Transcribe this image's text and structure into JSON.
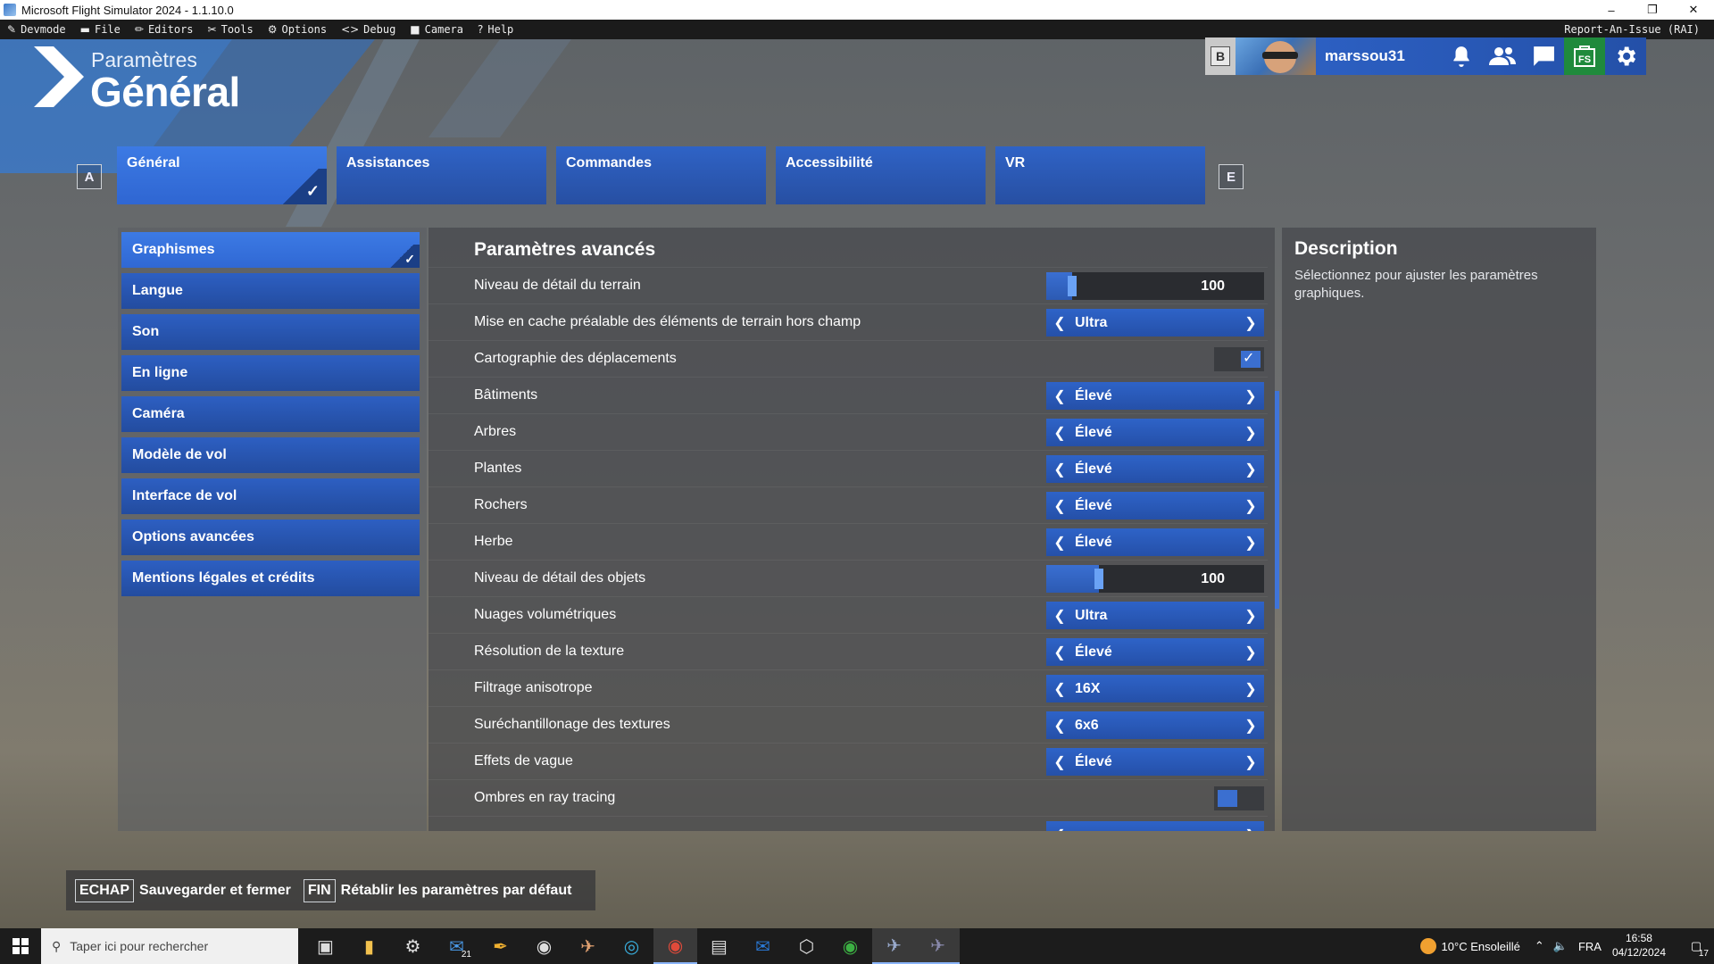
{
  "window": {
    "title": "Microsoft Flight Simulator 2024 - 1.1.10.0",
    "minimize": "–",
    "maximize": "❐",
    "close": "✕"
  },
  "devmenu": {
    "items": [
      {
        "icon": "✎",
        "label": "Devmode"
      },
      {
        "icon": "▬",
        "label": "File"
      },
      {
        "icon": "✏",
        "label": "Editors"
      },
      {
        "icon": "✂",
        "label": "Tools"
      },
      {
        "icon": "⚙",
        "label": "Options"
      },
      {
        "icon": "<>",
        "label": "Debug"
      },
      {
        "icon": "■",
        "label": "Camera"
      },
      {
        "icon": "?",
        "label": "Help"
      }
    ],
    "report": "Report-An-Issue (RAI)"
  },
  "header": {
    "subtitle": "Paramètres",
    "title": "Général"
  },
  "user": {
    "key": "B",
    "username": "marssou31",
    "icons": [
      "bell-icon",
      "friends-icon",
      "chat-icon",
      "store-icon",
      "settings-gear-icon"
    ]
  },
  "tabs": {
    "prev_key": "A",
    "next_key": "E",
    "items": [
      {
        "label": "Général",
        "active": true
      },
      {
        "label": "Assistances",
        "active": false
      },
      {
        "label": "Commandes",
        "active": false
      },
      {
        "label": "Accessibilité",
        "active": false
      },
      {
        "label": "VR",
        "active": false
      }
    ]
  },
  "left_menu": [
    {
      "label": "Graphismes",
      "active": true
    },
    {
      "label": "Langue"
    },
    {
      "label": "Son"
    },
    {
      "label": "En ligne"
    },
    {
      "label": "Caméra"
    },
    {
      "label": "Modèle de vol"
    },
    {
      "label": "Interface de vol"
    },
    {
      "label": "Options avancées"
    },
    {
      "label": "Mentions légales et crédits"
    }
  ],
  "settings": {
    "title": "Paramètres avancés",
    "rows": [
      {
        "label": "Niveau de détail du terrain",
        "type": "slider",
        "value": "100",
        "level": 0.12
      },
      {
        "label": "Mise en cache préalable des éléments de terrain hors champ",
        "type": "select",
        "value": "Ultra"
      },
      {
        "label": "Cartographie des déplacements",
        "type": "toggle",
        "on": true
      },
      {
        "label": "Bâtiments",
        "type": "select",
        "value": "Élevé"
      },
      {
        "label": "Arbres",
        "type": "select",
        "value": "Élevé"
      },
      {
        "label": "Plantes",
        "type": "select",
        "value": "Élevé"
      },
      {
        "label": "Rochers",
        "type": "select",
        "value": "Élevé"
      },
      {
        "label": "Herbe",
        "type": "select",
        "value": "Élevé"
      },
      {
        "label": "Niveau de détail des objets",
        "type": "slider",
        "value": "100",
        "level": 0.24
      },
      {
        "label": "Nuages volumétriques",
        "type": "select",
        "value": "Ultra"
      },
      {
        "label": "Résolution de la texture",
        "type": "select",
        "value": "Élevé"
      },
      {
        "label": "Filtrage anisotrope",
        "type": "select",
        "value": "16X"
      },
      {
        "label": "Suréchantillonage des textures",
        "type": "select",
        "value": "6x6"
      },
      {
        "label": "Effets de vague",
        "type": "select",
        "value": "Élevé"
      },
      {
        "label": "Ombres en ray tracing",
        "type": "toggle",
        "on": false
      }
    ]
  },
  "description": {
    "title": "Description",
    "text": "Sélectionnez pour ajuster les paramètres graphiques."
  },
  "actions": [
    {
      "key": "ECHAP",
      "label": "Sauvegarder et fermer"
    },
    {
      "key": "FIN",
      "label": "Rétablir les paramètres par défaut"
    }
  ],
  "taskbar": {
    "search_placeholder": "Taper ici pour rechercher",
    "mail_badge": "21",
    "weather": "10°C  Ensoleillé",
    "lang": "FRA",
    "time": "16:58",
    "date": "04/12/2024",
    "notif_badge": "17"
  },
  "colors": {
    "accent": "#2f63c6",
    "accent_active": "#3c7ae4",
    "store": "#1f8a3c"
  }
}
